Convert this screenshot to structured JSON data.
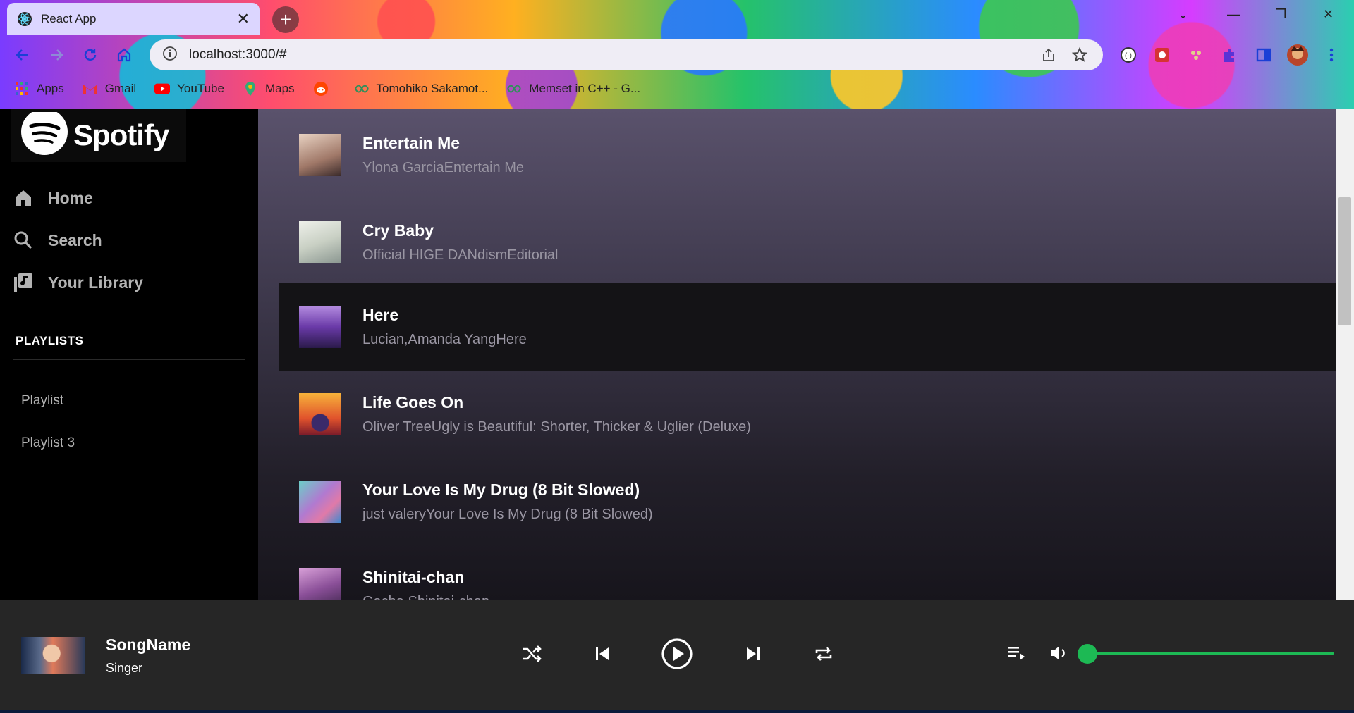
{
  "browser": {
    "tab_title": "React App",
    "tab_close": "✕",
    "new_tab": "+",
    "url": "localhost:3000/#",
    "bookmarks": [
      {
        "label": "Apps",
        "icon": "apps-grid-icon"
      },
      {
        "label": "Gmail",
        "icon": "gmail-icon"
      },
      {
        "label": "YouTube",
        "icon": "youtube-icon"
      },
      {
        "label": "Maps",
        "icon": "maps-pin-icon"
      },
      {
        "label": "",
        "icon": "reddit-icon"
      },
      {
        "label": "Tomohiko Sakamot...",
        "icon": "link-icon"
      },
      {
        "label": "Memset in C++ - G...",
        "icon": "link-icon"
      }
    ]
  },
  "sidebar": {
    "logo": "Spotify",
    "nav": [
      {
        "label": "Home",
        "icon": "home-icon"
      },
      {
        "label": "Search",
        "icon": "search-icon"
      },
      {
        "label": "Your Library",
        "icon": "library-icon"
      }
    ],
    "playlists_title": "PLAYLISTS",
    "playlists": [
      "Playlist",
      "Playlist 3"
    ]
  },
  "tracks": [
    {
      "title": "Entertain Me",
      "subtitle": "Ylona GarciaEntertain Me",
      "art": "#c7a58e"
    },
    {
      "title": "Cry Baby",
      "subtitle": "Official HIGE DANdismEditorial",
      "art": "#d9dcd4"
    },
    {
      "title": "Here",
      "subtitle": "Lucian,Amanda YangHere",
      "art": "#7a4fb4"
    },
    {
      "title": "Life Goes On",
      "subtitle": "Oliver TreeUgly is Beautiful: Shorter, Thicker & Uglier (Deluxe)",
      "art": "#e0622c"
    },
    {
      "title": "Your Love Is My Drug (8 Bit Slowed)",
      "subtitle": "just valeryYour Love Is My Drug (8 Bit Slowed)",
      "art": "#8a5fb0"
    },
    {
      "title": "Shinitai-chan",
      "subtitle": "Gacha Shinitai-chan",
      "art": "#a06aa8"
    }
  ],
  "player": {
    "song": "SongName",
    "artist": "Singer",
    "accent": "#1db954",
    "volume_fraction": 0.04
  }
}
